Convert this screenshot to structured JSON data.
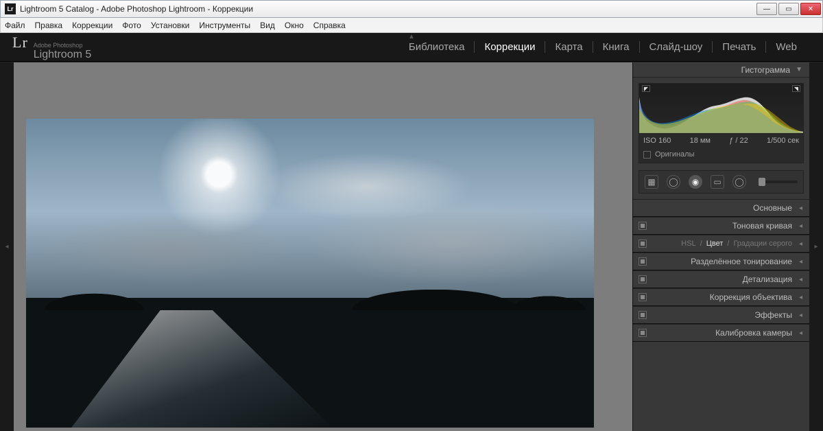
{
  "window": {
    "title": "Lightroom 5 Catalog - Adobe Photoshop Lightroom - Коррекции",
    "app_icon_text": "Lr"
  },
  "menubar": [
    "Файл",
    "Правка",
    "Коррекции",
    "Фото",
    "Установки",
    "Инструменты",
    "Вид",
    "Окно",
    "Справка"
  ],
  "identity": {
    "vendor": "Adobe Photoshop",
    "product": "Lightroom 5",
    "mark": "Lr"
  },
  "modules": [
    {
      "label": "Библиотека",
      "active": false
    },
    {
      "label": "Коррекции",
      "active": true
    },
    {
      "label": "Карта",
      "active": false
    },
    {
      "label": "Книга",
      "active": false
    },
    {
      "label": "Слайд-шоу",
      "active": false
    },
    {
      "label": "Печать",
      "active": false
    },
    {
      "label": "Web",
      "active": false
    }
  ],
  "histogram": {
    "title": "Гистограмма",
    "iso": "ISO 160",
    "focal": "18 мм",
    "aperture": "ƒ / 22",
    "shutter": "1/500 сек",
    "originals_label": "Оригиналы"
  },
  "panels": [
    {
      "label": "Основные",
      "switch": false
    },
    {
      "label": "Тоновая кривая",
      "switch": true
    },
    {
      "label": "",
      "switch": true,
      "hsl": {
        "a": "HSL",
        "b": "Цвет",
        "c": "Градации серого"
      }
    },
    {
      "label": "Разделённое тонирование",
      "switch": true
    },
    {
      "label": "Детализация",
      "switch": true
    },
    {
      "label": "Коррекция объектива",
      "switch": true
    },
    {
      "label": "Эффекты",
      "switch": true
    },
    {
      "label": "Калибровка камеры",
      "switch": true
    }
  ]
}
